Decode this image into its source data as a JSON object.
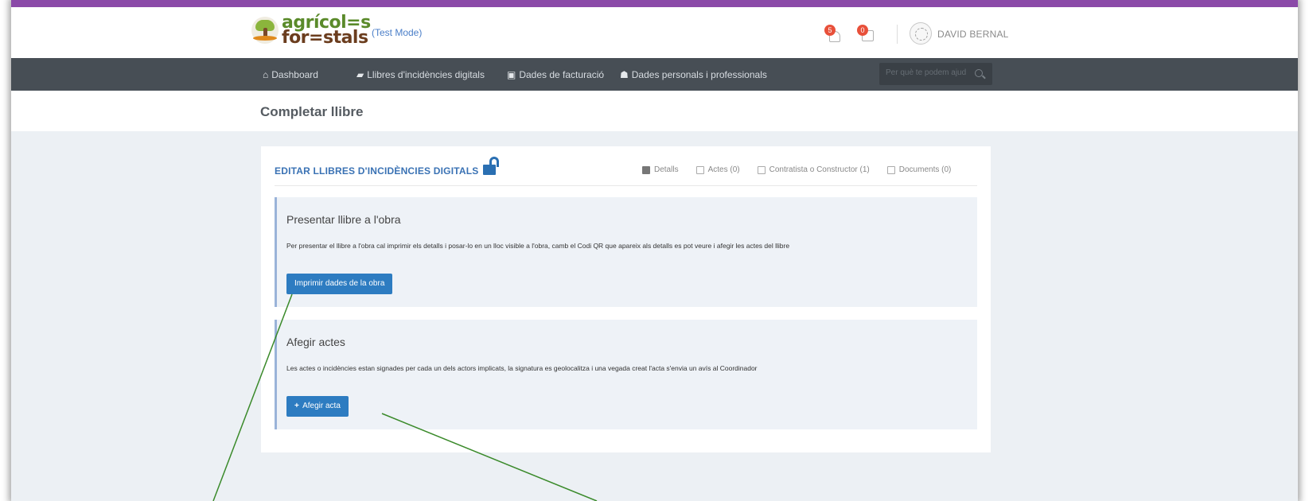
{
  "header": {
    "logo_text": "agricoles forestals",
    "logo_line1": "agrícol=s",
    "logo_line2": "for=stals",
    "test_mode": "(Test Mode)",
    "notifications_count": "5",
    "calendar_count": "0",
    "user_name": "DAVID BERNAL"
  },
  "nav": {
    "items": [
      {
        "label": "Dashboard",
        "icon": "home-icon"
      },
      {
        "label": "Llibres d'incidències digitals",
        "icon": "book-icon"
      },
      {
        "label": "Dades de facturació",
        "icon": "money-icon"
      },
      {
        "label": "Dades personals i professionals",
        "icon": "users-icon"
      }
    ],
    "search_placeholder": "Per què te podem ajud"
  },
  "page": {
    "title": "Completar llibre"
  },
  "card": {
    "title": "EDITAR LLIBRES D'INCIDÈNCIES DIGITALS",
    "tabs": [
      {
        "label": "Detalls",
        "icon": "book-icon"
      },
      {
        "label": "Actes (0)",
        "icon": "file-icon"
      },
      {
        "label": "Contratista o Constructor (1)",
        "icon": "id-card-icon"
      },
      {
        "label": "Documents (0)",
        "icon": "copy-icon"
      }
    ],
    "section1": {
      "heading": "Presentar llibre a l'obra",
      "text": "Per presentar el llibre a l'obra cal imprimir els detalls i posar-lo en un lloc visible a l'obra, camb el Codi QR que apareix als detalls es pot veure i afegir les actes del llibre",
      "button": "Imprimir dades de la obra"
    },
    "section2": {
      "heading": "Afegir actes",
      "text": "Les actes o incidències estan signades per cada un dels actors implicats, la signatura es geolocalitza i una vegada creat l'acta s'envia un avís al Coordinador",
      "button": "Afegir acta",
      "button_prefix": "+"
    }
  },
  "colors": {
    "accent_bar": "#8b4aa8",
    "nav_bg": "#474e55",
    "primary_button": "#2d7cc1",
    "card_title": "#3a72b4",
    "annotation_arrow": "#3a8a2a"
  }
}
